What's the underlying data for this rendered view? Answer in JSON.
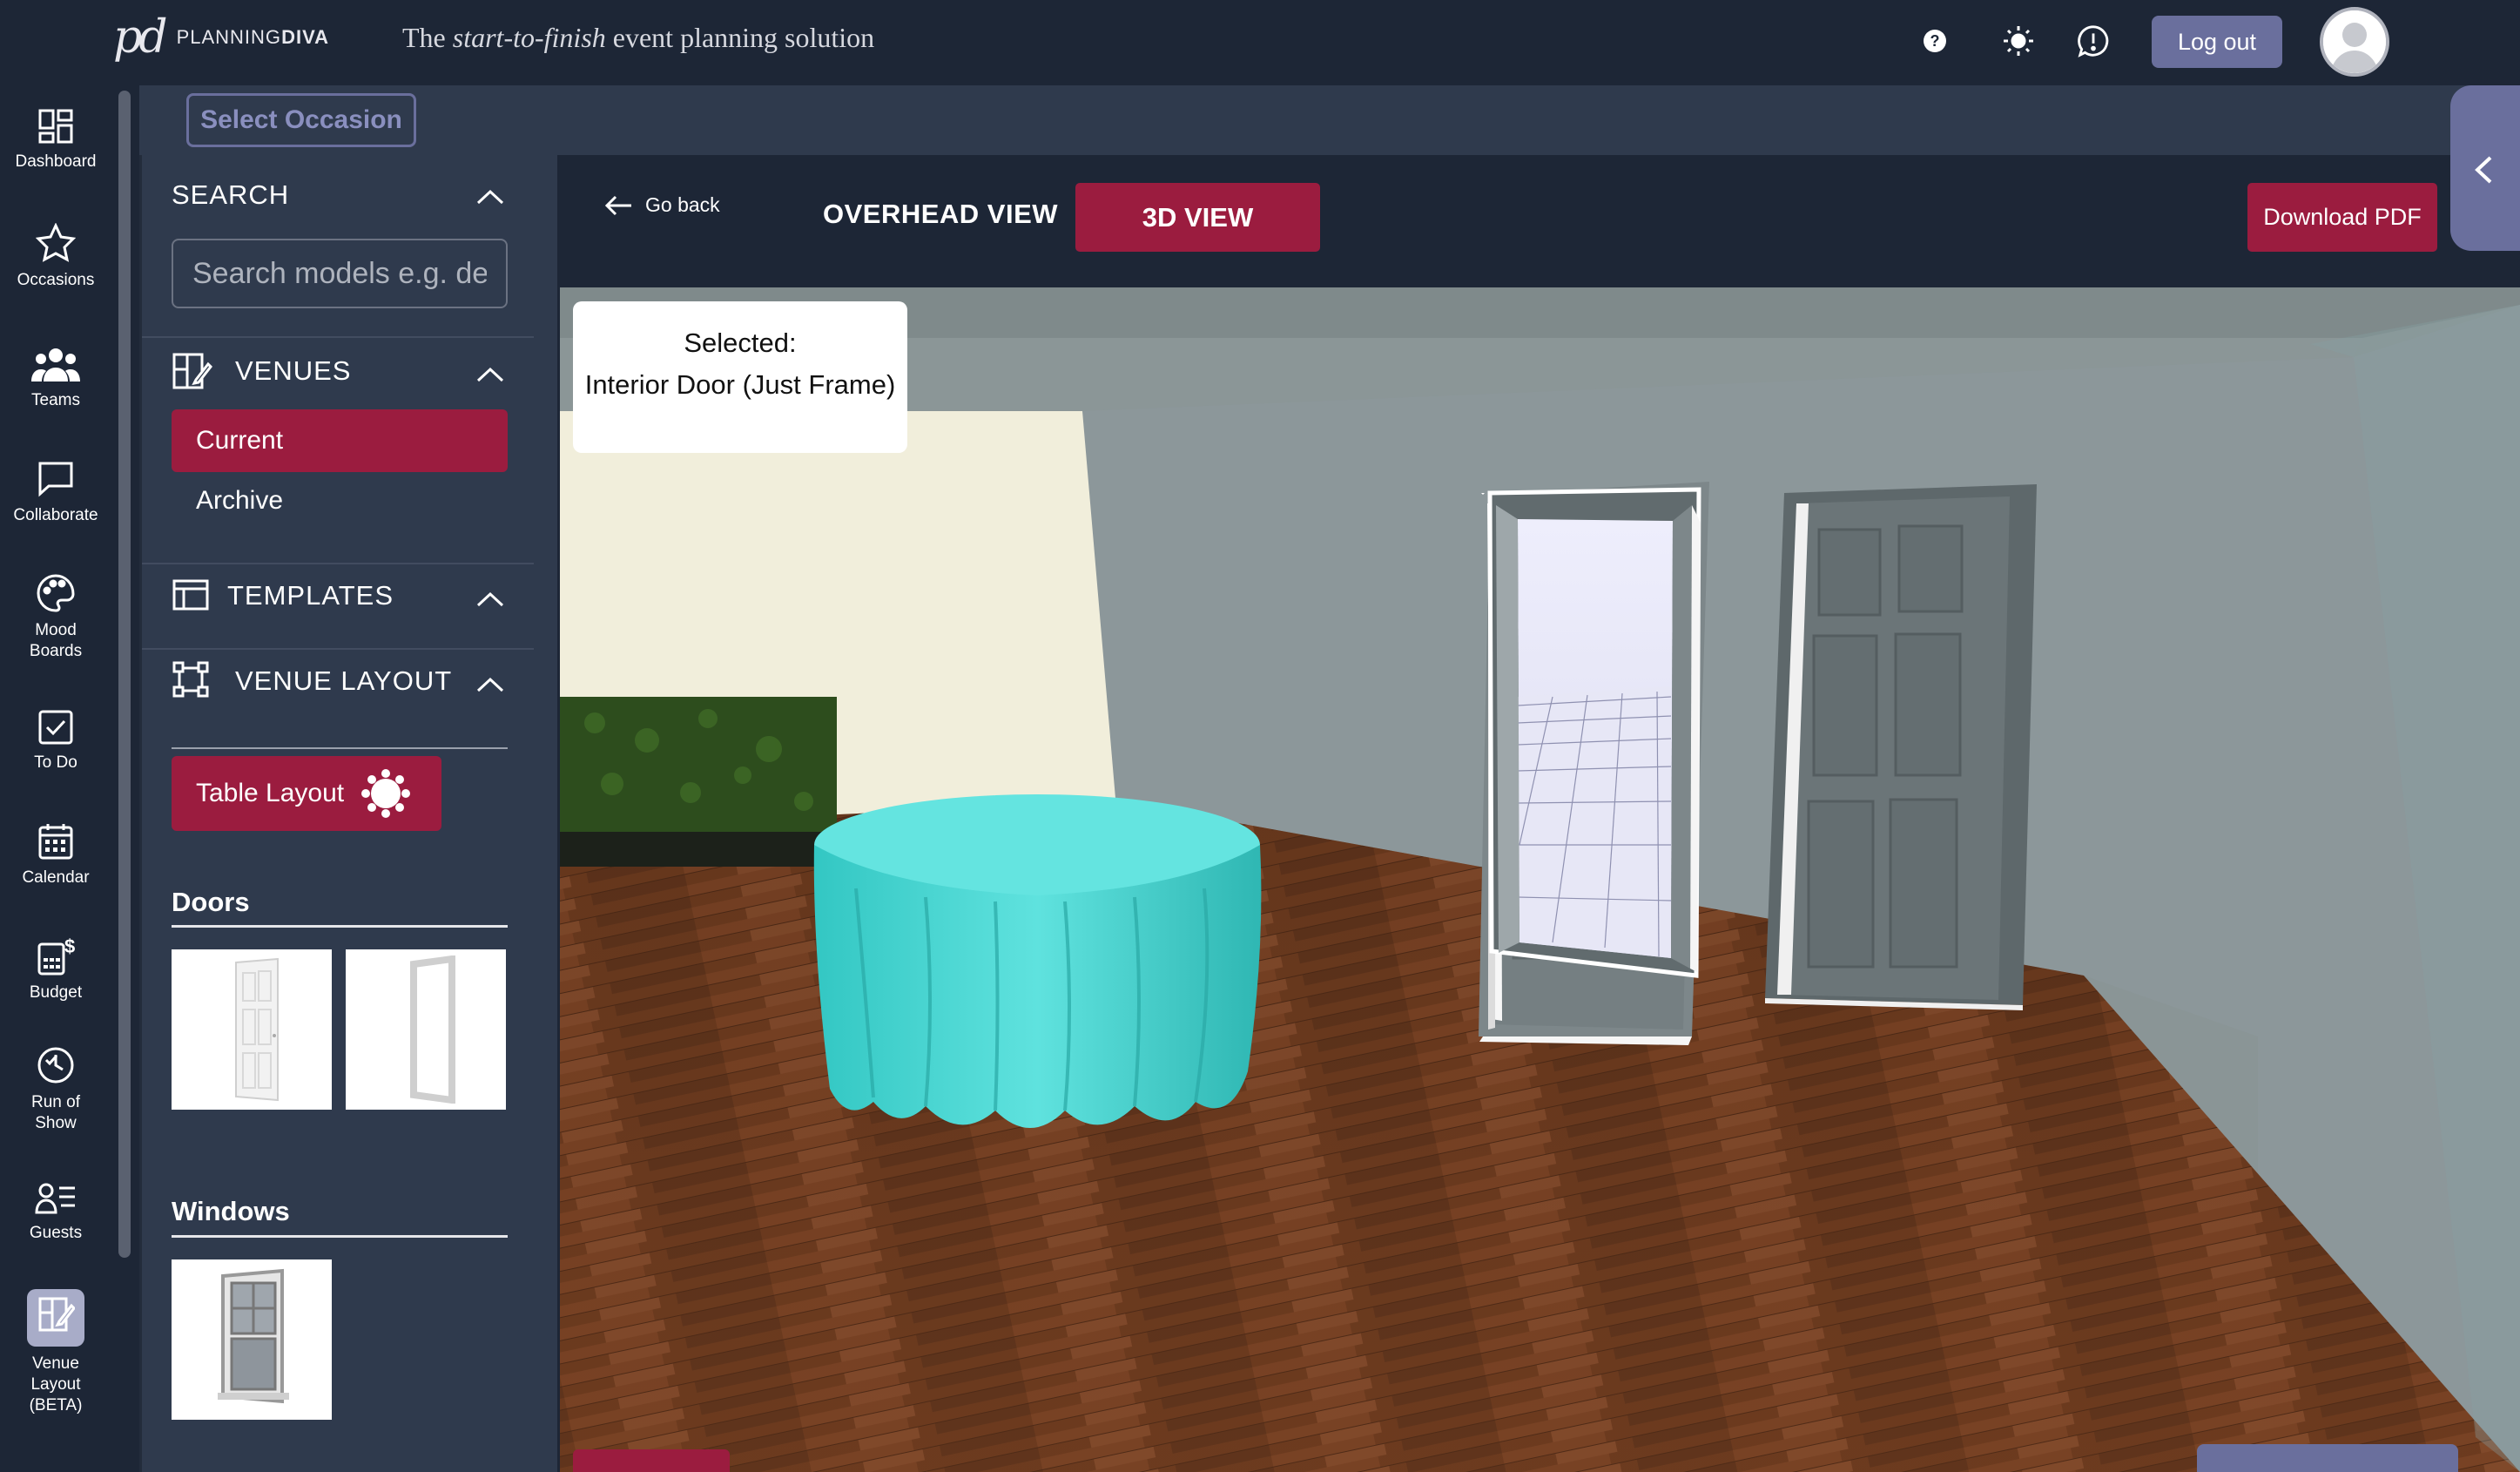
{
  "app": {
    "brand": "PLANNINGDIVA",
    "brand_plain": "PLANNING",
    "brand_bold": "DIVA",
    "tagline_pre": "The ",
    "tagline_italic": "start-to-finish",
    "tagline_post": " event planning solution",
    "logout_label": "Log out"
  },
  "nav": {
    "items": [
      {
        "label": "Dashboard",
        "icon": "dashboard-icon"
      },
      {
        "label": "Occasions",
        "icon": "star-icon"
      },
      {
        "label": "Teams",
        "icon": "teams-icon"
      },
      {
        "label": "Collaborate",
        "icon": "chat-icon"
      },
      {
        "label": "Mood Boards",
        "icon": "palette-icon"
      },
      {
        "label": "To Do",
        "icon": "checkbox-icon"
      },
      {
        "label": "Calendar",
        "icon": "calendar-icon"
      },
      {
        "label": "Budget",
        "icon": "budget-icon"
      },
      {
        "label": "Run of Show",
        "icon": "clock-icon"
      },
      {
        "label": "Guests",
        "icon": "guests-icon"
      },
      {
        "label": "Venue Layout (BETA)",
        "icon": "venue-layout-icon"
      }
    ]
  },
  "subheader": {
    "select_occasion": "Select Occasion"
  },
  "panel": {
    "search": {
      "title": "SEARCH",
      "placeholder": "Search models e.g. desk"
    },
    "venues": {
      "title": "VENUES",
      "current": "Current",
      "archive": "Archive"
    },
    "templates": {
      "title": "TEMPLATES"
    },
    "venue_layout": {
      "title": "VENUE LAYOUT",
      "table_layout": "Table Layout"
    },
    "doors": {
      "title": "Doors"
    },
    "windows": {
      "title": "Windows"
    }
  },
  "viewer": {
    "go_back": "Go back",
    "overhead_view": "OVERHEAD VIEW",
    "view_3d": "3D VIEW",
    "download_pdf": "Download PDF",
    "selected_label": "Selected:",
    "selected_item": "Interior Door (Just Frame)"
  },
  "colors": {
    "accent": "#9b1c3f",
    "navy": "#1d2636",
    "panel": "#2f3a4d",
    "lavender": "#6a6f9d",
    "tablecloth": "#4fd6d2"
  }
}
